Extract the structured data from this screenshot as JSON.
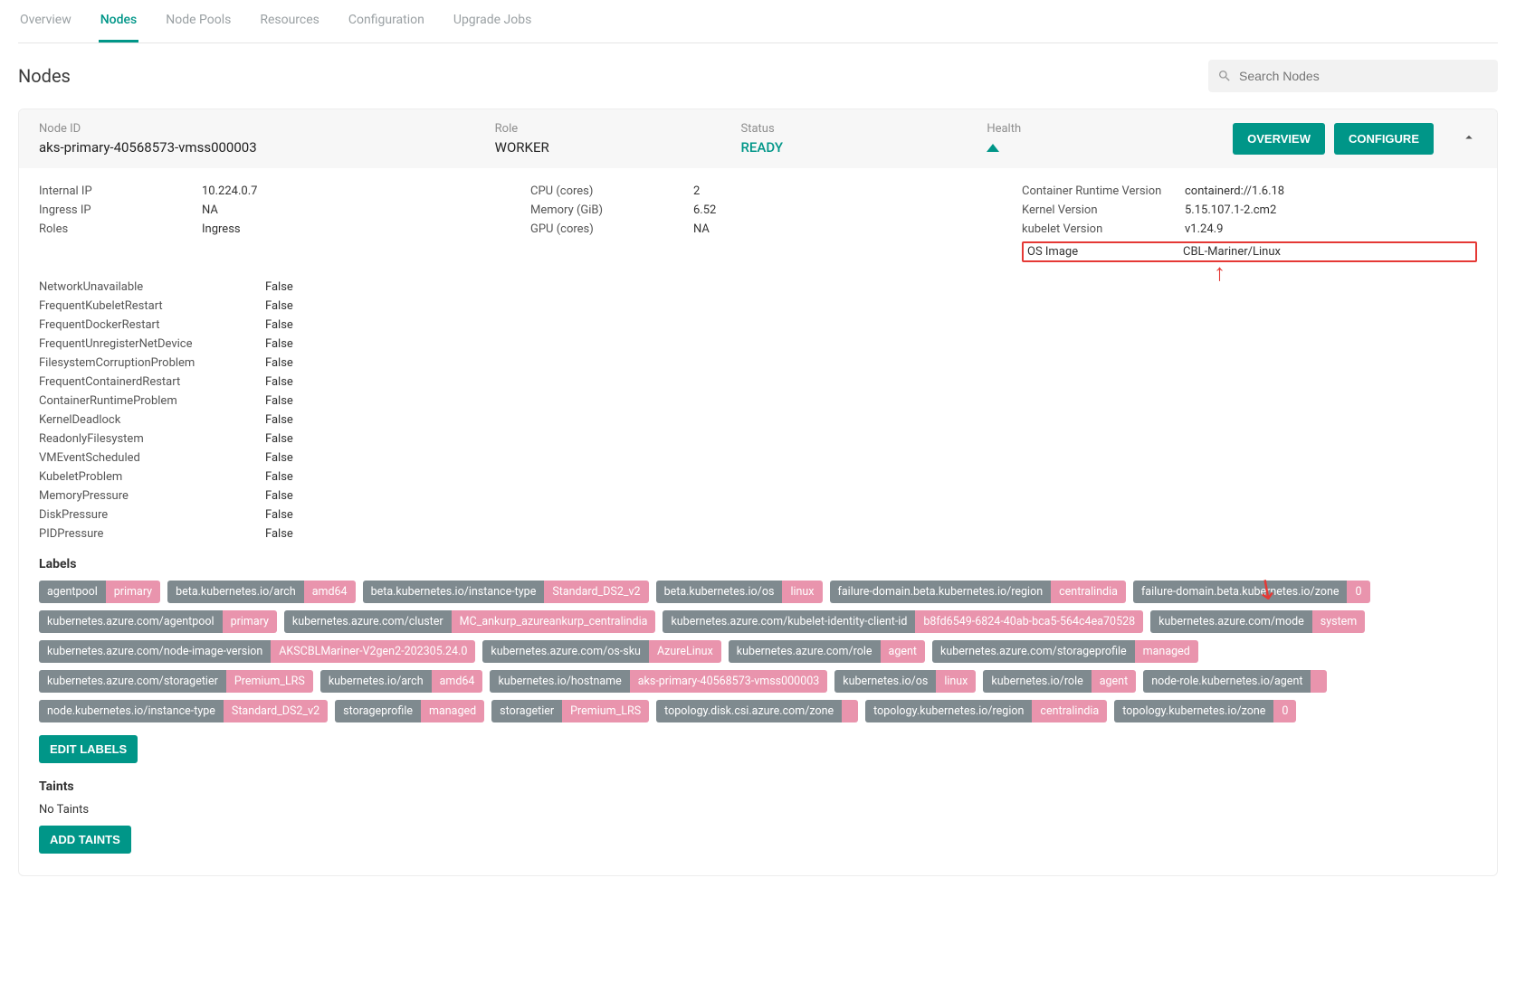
{
  "tabs": [
    "Overview",
    "Nodes",
    "Node Pools",
    "Resources",
    "Configuration",
    "Upgrade Jobs"
  ],
  "activeTab": "Nodes",
  "pageTitle": "Nodes",
  "search": {
    "placeholder": "Search Nodes"
  },
  "header": {
    "labels": {
      "nodeId": "Node ID",
      "role": "Role",
      "status": "Status",
      "health": "Health"
    },
    "nodeId": "aks-primary-40568573-vmss000003",
    "role": "WORKER",
    "status": "READY",
    "overviewBtn": "OVERVIEW",
    "configureBtn": "CONFIGURE"
  },
  "infoCols": {
    "col1": [
      {
        "k": "Internal IP",
        "v": "10.224.0.7"
      },
      {
        "k": "Ingress IP",
        "v": "NA"
      },
      {
        "k": "Roles",
        "v": "Ingress"
      }
    ],
    "col2": [
      {
        "k": "CPU (cores)",
        "v": "2"
      },
      {
        "k": "Memory (GiB)",
        "v": "6.52"
      },
      {
        "k": "GPU (cores)",
        "v": "NA"
      }
    ],
    "col3": [
      {
        "k": "Container Runtime Version",
        "v": "containerd://1.6.18"
      },
      {
        "k": "Kernel Version",
        "v": "5.15.107.1-2.cm2"
      },
      {
        "k": "kubelet Version",
        "v": "v1.24.9"
      }
    ],
    "osImage": {
      "k": "OS Image",
      "v": "CBL-Mariner/Linux"
    }
  },
  "conditions": [
    {
      "k": "NetworkUnavailable",
      "v": "False"
    },
    {
      "k": "FrequentKubeletRestart",
      "v": "False"
    },
    {
      "k": "FrequentDockerRestart",
      "v": "False"
    },
    {
      "k": "FrequentUnregisterNetDevice",
      "v": "False"
    },
    {
      "k": "FilesystemCorruptionProblem",
      "v": "False"
    },
    {
      "k": "FrequentContainerdRestart",
      "v": "False"
    },
    {
      "k": "ContainerRuntimeProblem",
      "v": "False"
    },
    {
      "k": "KernelDeadlock",
      "v": "False"
    },
    {
      "k": "ReadonlyFilesystem",
      "v": "False"
    },
    {
      "k": "VMEventScheduled",
      "v": "False"
    },
    {
      "k": "KubeletProblem",
      "v": "False"
    },
    {
      "k": "MemoryPressure",
      "v": "False"
    },
    {
      "k": "DiskPressure",
      "v": "False"
    },
    {
      "k": "PIDPressure",
      "v": "False"
    }
  ],
  "labelsTitle": "Labels",
  "labels": [
    {
      "k": "agentpool",
      "v": "primary"
    },
    {
      "k": "beta.kubernetes.io/arch",
      "v": "amd64"
    },
    {
      "k": "beta.kubernetes.io/instance-type",
      "v": "Standard_DS2_v2"
    },
    {
      "k": "beta.kubernetes.io/os",
      "v": "linux"
    },
    {
      "k": "failure-domain.beta.kubernetes.io/region",
      "v": "centralindia"
    },
    {
      "k": "failure-domain.beta.kubernetes.io/zone",
      "v": "0"
    },
    {
      "k": "kubernetes.azure.com/agentpool",
      "v": "primary"
    },
    {
      "k": "kubernetes.azure.com/cluster",
      "v": "MC_ankurp_azureankurp_centralindia"
    },
    {
      "k": "kubernetes.azure.com/kubelet-identity-client-id",
      "v": "b8fd6549-6824-40ab-bca5-564c4ea70528"
    },
    {
      "k": "kubernetes.azure.com/mode",
      "v": "system"
    },
    {
      "k": "kubernetes.azure.com/node-image-version",
      "v": "AKSCBLMariner-V2gen2-202305.24.0"
    },
    {
      "k": "kubernetes.azure.com/os-sku",
      "v": "AzureLinux"
    },
    {
      "k": "kubernetes.azure.com/role",
      "v": "agent"
    },
    {
      "k": "kubernetes.azure.com/storageprofile",
      "v": "managed"
    },
    {
      "k": "kubernetes.azure.com/storagetier",
      "v": "Premium_LRS"
    },
    {
      "k": "kubernetes.io/arch",
      "v": "amd64"
    },
    {
      "k": "kubernetes.io/hostname",
      "v": "aks-primary-40568573-vmss000003"
    },
    {
      "k": "kubernetes.io/os",
      "v": "linux"
    },
    {
      "k": "kubernetes.io/role",
      "v": "agent"
    },
    {
      "k": "node-role.kubernetes.io/agent",
      "v": ""
    },
    {
      "k": "node.kubernetes.io/instance-type",
      "v": "Standard_DS2_v2"
    },
    {
      "k": "storageprofile",
      "v": "managed"
    },
    {
      "k": "storagetier",
      "v": "Premium_LRS"
    },
    {
      "k": "topology.disk.csi.azure.com/zone",
      "v": ""
    },
    {
      "k": "topology.kubernetes.io/region",
      "v": "centralindia"
    },
    {
      "k": "topology.kubernetes.io/zone",
      "v": "0"
    }
  ],
  "editLabelsBtn": "EDIT LABELS",
  "taintsTitle": "Taints",
  "taintsNone": "No Taints",
  "addTaintsBtn": "ADD TAINTS"
}
